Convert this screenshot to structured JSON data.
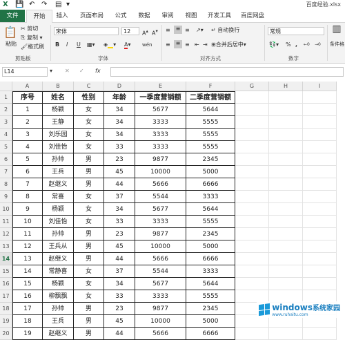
{
  "titlebar": {
    "doc_title": "百度经验.xlsx"
  },
  "tabs": [
    "文件",
    "开始",
    "插入",
    "页面布局",
    "公式",
    "数据",
    "审阅",
    "视图",
    "开发工具",
    "百度网盘"
  ],
  "ribbon": {
    "paste": "粘贴",
    "cut": "剪切",
    "copy": "复制",
    "format_painter": "格式刷",
    "clipboard_group": "剪贴板",
    "font_name": "宋体",
    "font_size": "12",
    "bold": "B",
    "italic": "I",
    "underline": "U",
    "wen": "wén",
    "font_group": "字体",
    "wrap_text": "自动换行",
    "merge_center": "合并后居中",
    "align_group": "对齐方式",
    "number_format": "常规",
    "percent": "%",
    "comma": ",",
    "number_group": "数字",
    "conditional_format": "条件格"
  },
  "formula_bar": {
    "name_box": "L14",
    "fx": "fx",
    "value": ""
  },
  "columns": [
    "A",
    "B",
    "C",
    "D",
    "E",
    "F",
    "G",
    "H",
    "I"
  ],
  "row_numbers": [
    "1",
    "2",
    "3",
    "4",
    "5",
    "6",
    "7",
    "8",
    "9",
    "10",
    "11",
    "12",
    "13",
    "14",
    "15",
    "16",
    "17",
    "18",
    "19",
    "20"
  ],
  "table": {
    "headers": [
      "序号",
      "姓名",
      "性别",
      "年龄",
      "一季度营销额",
      "二季度营销额"
    ],
    "rows": [
      [
        "1",
        "杨颖",
        "女",
        "34",
        "5677",
        "5644"
      ],
      [
        "2",
        "王静",
        "女",
        "34",
        "3333",
        "5555"
      ],
      [
        "3",
        "刘乐园",
        "女",
        "34",
        "3333",
        "5555"
      ],
      [
        "4",
        "刘佳怡",
        "女",
        "33",
        "3333",
        "5555"
      ],
      [
        "5",
        "孙帅",
        "男",
        "23",
        "9877",
        "2345"
      ],
      [
        "6",
        "王兵",
        "男",
        "45",
        "10000",
        "5000"
      ],
      [
        "7",
        "赵继义",
        "男",
        "44",
        "5666",
        "6666"
      ],
      [
        "8",
        "常喜",
        "女",
        "37",
        "5544",
        "3333"
      ],
      [
        "9",
        "杨颖",
        "女",
        "34",
        "5677",
        "5644"
      ],
      [
        "10",
        "刘佳怡",
        "女",
        "33",
        "3333",
        "5555"
      ],
      [
        "11",
        "孙帅",
        "男",
        "23",
        "9877",
        "2345"
      ],
      [
        "12",
        "王兵从",
        "男",
        "45",
        "10000",
        "5000"
      ],
      [
        "13",
        "赵继义",
        "男",
        "44",
        "5666",
        "6666"
      ],
      [
        "14",
        "常静喜",
        "女",
        "37",
        "5544",
        "3333"
      ],
      [
        "15",
        "杨颖",
        "女",
        "34",
        "5677",
        "5644"
      ],
      [
        "16",
        "柳飘飘",
        "女",
        "33",
        "3333",
        "5555"
      ],
      [
        "17",
        "孙帅",
        "男",
        "23",
        "9877",
        "2345"
      ],
      [
        "18",
        "王兵",
        "男",
        "45",
        "10000",
        "5000"
      ],
      [
        "19",
        "赵继义",
        "男",
        "44",
        "5666",
        "6666"
      ]
    ]
  },
  "watermark": {
    "brand": "windows",
    "suffix": "系统家园",
    "url": "www.ruhaitu.com"
  },
  "colors": {
    "file_tab": "#217346",
    "ribbon_bg": "#f3f3f3",
    "font_color_red": "#e02020",
    "fill_yellow": "#ffd700"
  }
}
